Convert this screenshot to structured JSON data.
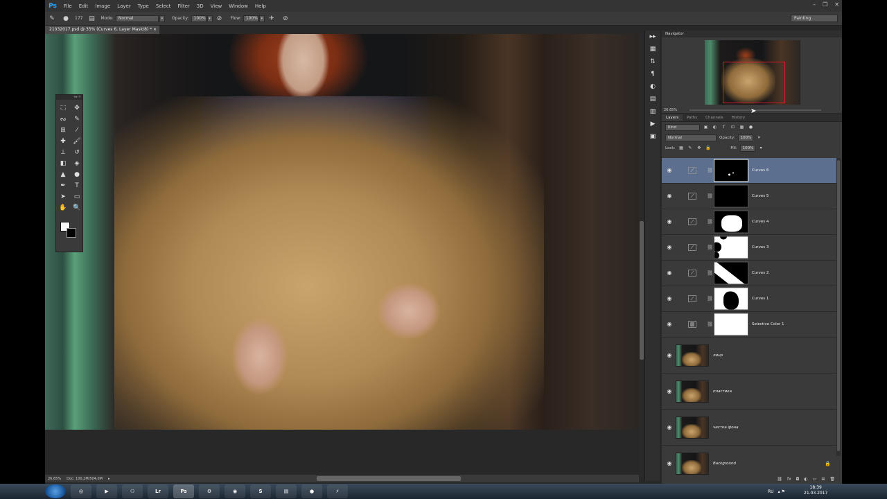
{
  "app": {
    "logo": "Ps",
    "menu": [
      "File",
      "Edit",
      "Image",
      "Layer",
      "Type",
      "Select",
      "Filter",
      "3D",
      "View",
      "Window",
      "Help"
    ],
    "window_controls": [
      "–",
      "❐",
      "✕"
    ],
    "workspace": "Painting"
  },
  "options": {
    "brush_size": "177",
    "mode_label": "Mode:",
    "mode_value": "Normal",
    "opacity_label": "Opacity:",
    "opacity_value": "100%",
    "flow_label": "Flow:",
    "flow_value": "100%"
  },
  "document": {
    "tab_title": "21032017.psd @ 35% (Curves 6, Layer Mask/8) *",
    "zoom": "26,65%",
    "doc_size": "Doc: 100,2M/504,0M"
  },
  "navigator": {
    "title": "Navigator",
    "zoom": "26.65%"
  },
  "layers_panel": {
    "tabs": [
      "Layers",
      "Paths",
      "Channels",
      "History"
    ],
    "filter_kind": "Kind",
    "blend_mode": "Normal",
    "opacity_label": "Opacity:",
    "opacity_value": "100%",
    "lock_label": "Lock:",
    "fill_label": "Fill:",
    "fill_value": "100%",
    "layers": [
      {
        "name": "Curves 6",
        "selected": true
      },
      {
        "name": "Curves 5"
      },
      {
        "name": "Curves 4"
      },
      {
        "name": "Curves 3"
      },
      {
        "name": "Curves 2"
      },
      {
        "name": "Curves 1"
      },
      {
        "name": "Selective Color 1"
      },
      {
        "name": "лицо"
      },
      {
        "name": "пластика"
      },
      {
        "name": "чистка фона"
      },
      {
        "name": "Background"
      }
    ]
  },
  "taskbar": {
    "apps": [
      "Lr",
      "Ps"
    ],
    "language": "RU",
    "time": "18:39",
    "date": "21.03.2017"
  },
  "colors": {
    "foreground": "#f7f7f7",
    "background": "#000000",
    "selection": "#5c6f8f",
    "navigator_view": "#e3182c"
  }
}
